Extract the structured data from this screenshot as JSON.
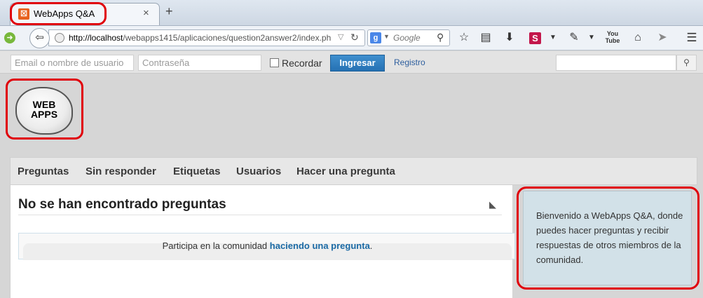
{
  "browser": {
    "tab_title": "WebApps Q&A",
    "tab_close": "×",
    "new_tab": "+",
    "url_host": "http://localhost",
    "url_path": "/webapps1415/aplicaciones/question2answer2/index.ph",
    "search_engine_placeholder": "Google",
    "toolbar_icons": [
      "star-icon",
      "clipboard-icon",
      "download-icon",
      "s-extension-icon",
      "eyedropper-icon",
      "youtube-icon",
      "home-icon",
      "send-icon",
      "menu-icon"
    ],
    "youtube_label": "You Tube"
  },
  "login": {
    "username_placeholder": "Email o nombre de usuario",
    "password_placeholder": "Contraseña",
    "remember_label": "Recordar",
    "submit_label": "Ingresar",
    "register_label": "Registro"
  },
  "logo": {
    "line1": "WEB",
    "line2": "APPS"
  },
  "nav": {
    "items": [
      "Preguntas",
      "Sin responder",
      "Etiquetas",
      "Usuarios",
      "Hacer una pregunta"
    ]
  },
  "main": {
    "title": "No se han encontrado preguntas",
    "notice_prefix": "Participa en la comunidad ",
    "notice_link": "haciendo una pregunta",
    "notice_suffix": "."
  },
  "sidebar": {
    "welcome": "Bienvenido a WebApps Q&A, donde puedes hacer preguntas y recibir respuestas de otros miembros de la comunidad."
  },
  "colors": {
    "highlight": "#e0000a",
    "link": "#1b6aa5",
    "button": "#2f7fbf",
    "sidebar_bg": "#d2e1e8"
  }
}
